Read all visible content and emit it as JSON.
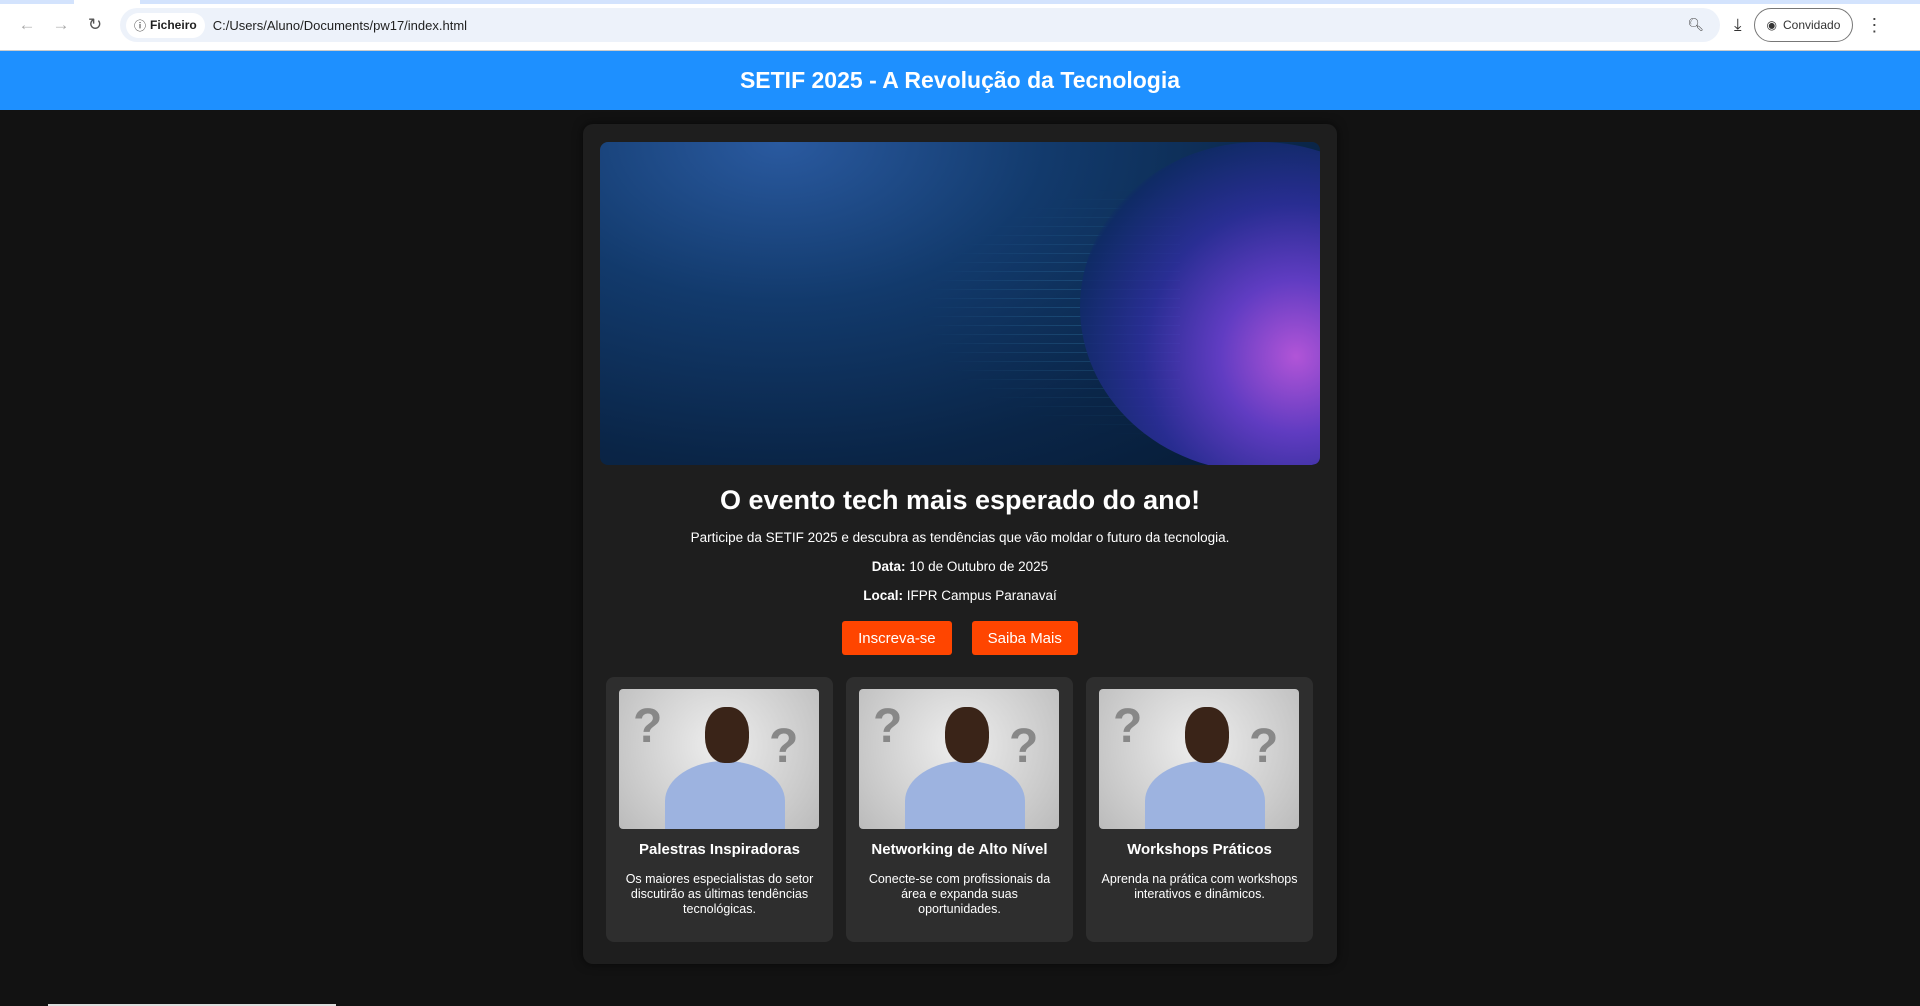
{
  "browser": {
    "site_chip": "Ficheiro",
    "url": "C:/Users/Aluno/Documents/pw17/index.html",
    "profile": "Convidado"
  },
  "header": {
    "title": "SETIF 2025 - A Revolução da Tecnologia"
  },
  "main": {
    "headline": "O evento tech mais esperado do ano!",
    "intro": "Participe da SETIF 2025 e descubra as tendências que vão moldar o futuro da tecnologia.",
    "date_label": "Data:",
    "date_value": "10 de Outubro de 2025",
    "place_label": "Local:",
    "place_value": "IFPR Campus Paranavaí",
    "buttons": {
      "subscribe": "Inscreva-se",
      "more": "Saiba Mais"
    },
    "cards": [
      {
        "title": "Palestras Inspiradoras",
        "text": "Os maiores especialistas do setor discutirão as últimas tendências tecnológicas."
      },
      {
        "title": "Networking de Alto Nível",
        "text": "Conecte-se com profissionais da área e expanda suas oportunidades."
      },
      {
        "title": "Workshops Práticos",
        "text": "Aprenda na prática com workshops interativos e dinâmicos."
      }
    ]
  },
  "colors": {
    "header": "#1e90ff",
    "button": "#ff4500",
    "background": "#121212"
  }
}
